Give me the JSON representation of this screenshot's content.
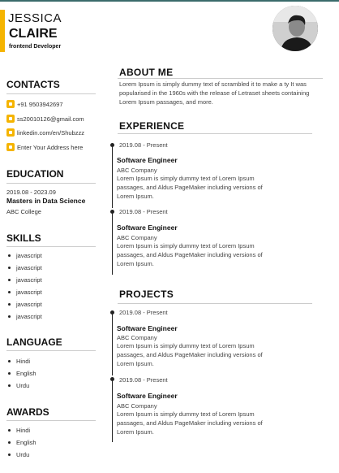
{
  "profile": {
    "first_name": "JESSICA",
    "last_name": "CLAIRE",
    "role": "frontend Developer"
  },
  "contacts": {
    "title": "CONTACTS",
    "items": [
      {
        "icon": "phone-icon",
        "text": "+91 9503942697"
      },
      {
        "icon": "email-icon",
        "text": "ss20010126@gmail.com"
      },
      {
        "icon": "linkedin-icon",
        "text": "linkedin.com/en/Shubzzz"
      },
      {
        "icon": "location-icon",
        "text": "Enter Your Address here"
      }
    ]
  },
  "education": {
    "title": "EDUCATION",
    "dates": "2019.08 - 2023.09",
    "degree": "Masters in Data Science",
    "school": "ABC College"
  },
  "skills": {
    "title": "SKILLS",
    "items": [
      "javascript",
      "javascript",
      "javascript",
      "javascript",
      "javascript",
      "javascript"
    ]
  },
  "language": {
    "title": "LANGUAGE",
    "items": [
      "Hindi",
      "English",
      "Urdu"
    ]
  },
  "awards": {
    "title": "AWARDS",
    "items": [
      "Hindi",
      "English",
      "Urdu"
    ]
  },
  "about": {
    "title": "ABOUT ME",
    "text": "Lorem Ipsum is simply dummy text of scrambled it to make a ty It was popularised in the 1960s with the release of Letraset sheets containing Lorem Ipsum passages, and more."
  },
  "experience": {
    "title": "EXPERIENCE",
    "items": [
      {
        "date": "2019.08 - Present",
        "title": "Software Engineer",
        "company": "ABC Company",
        "desc": "Lorem Ipsum is simply dummy text of Lorem Ipsum passages, and Aldus PageMaker including versions of Lorem Ipsum."
      },
      {
        "date": "2019.08 - Present",
        "title": "Software Engineer",
        "company": "ABC Company",
        "desc": "Lorem Ipsum is simply dummy text of Lorem Ipsum passages, and Aldus PageMaker including versions of Lorem Ipsum."
      }
    ]
  },
  "projects": {
    "title": "PROJECTS",
    "items": [
      {
        "date": "2019.08 - Present",
        "title": "Software Engineer",
        "company": "ABC Company",
        "desc": "Lorem Ipsum is simply dummy text of Lorem Ipsum passages, and Aldus PageMaker including versions of Lorem Ipsum."
      },
      {
        "date": "2019.08 - Present",
        "title": "Software Engineer",
        "company": "ABC Company",
        "desc": "Lorem Ipsum is simply dummy text of Lorem Ipsum passages, and Aldus PageMaker including versions of Lorem Ipsum."
      }
    ]
  },
  "colors": {
    "accent": "#f5b400",
    "timeline": "#222222"
  }
}
